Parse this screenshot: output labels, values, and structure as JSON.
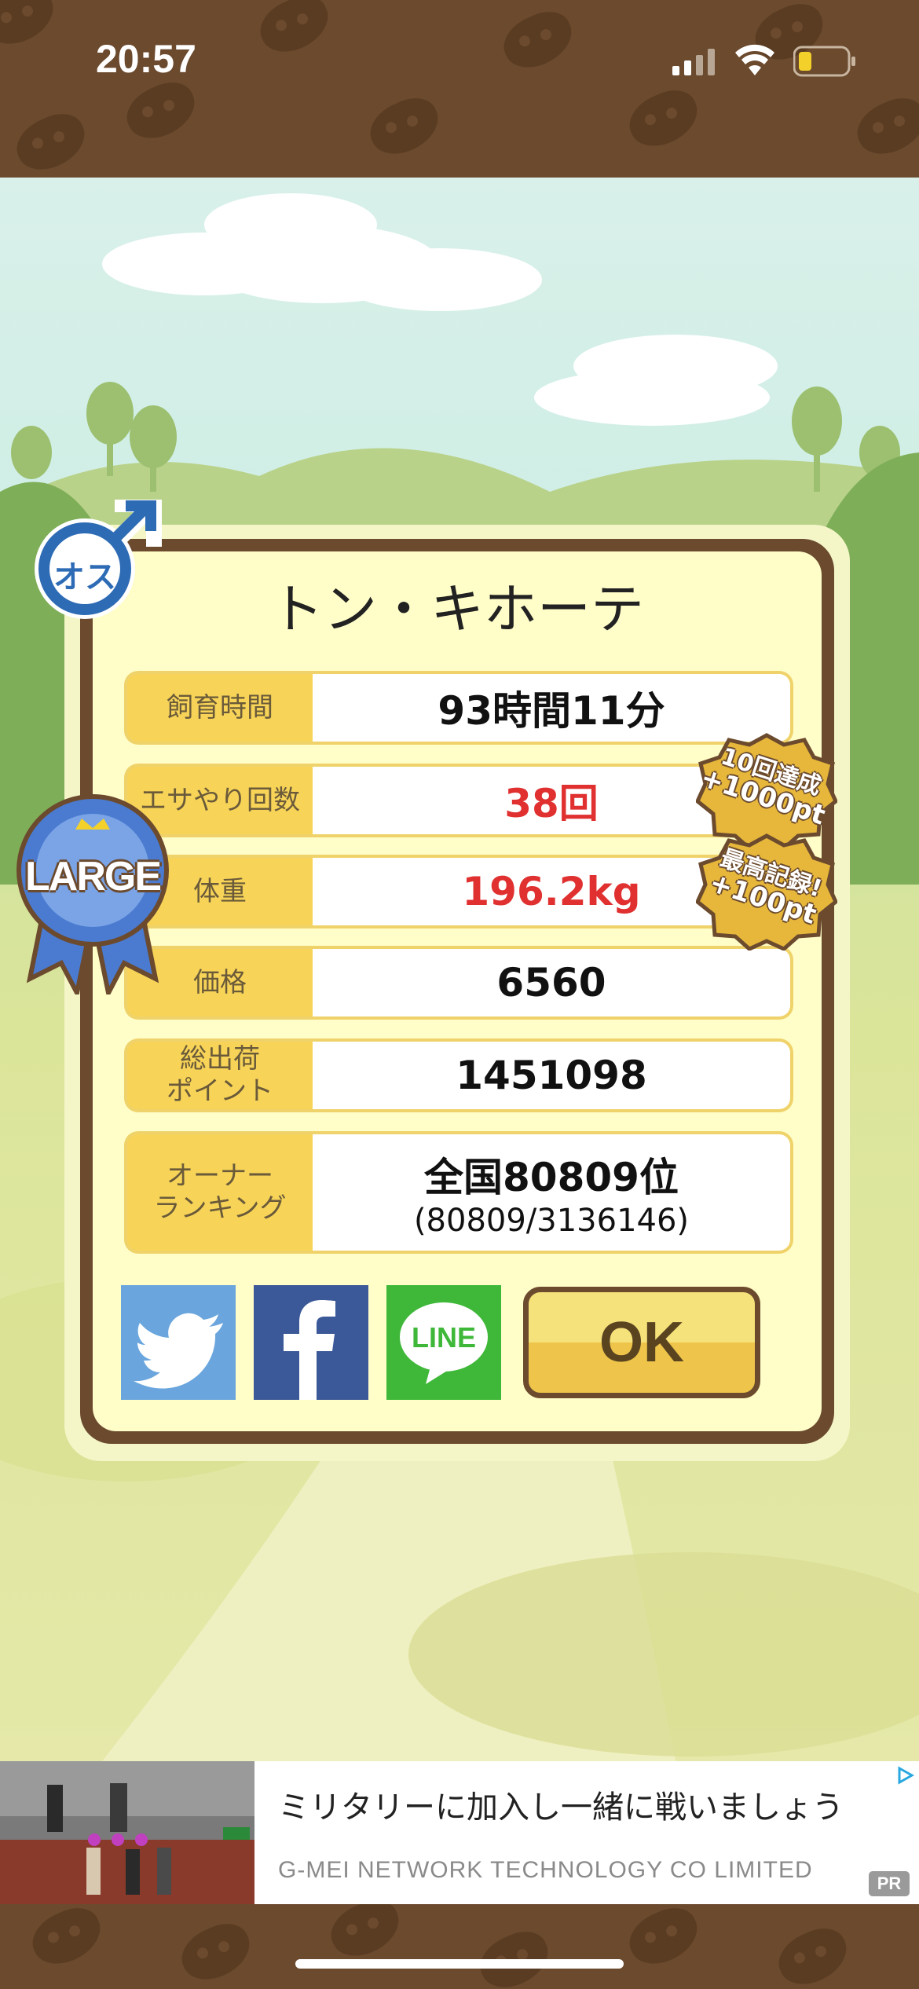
{
  "status_bar": {
    "time": "20:57"
  },
  "popup": {
    "title": "トン・キホーテ",
    "rows": [
      {
        "label": "飼育時間",
        "value": "93時間11分"
      },
      {
        "label": "エサやり回数",
        "value": "38回"
      },
      {
        "label": "体重",
        "value": "196.2kg"
      },
      {
        "label": "価格",
        "value": "6560"
      },
      {
        "label_line1": "総出荷",
        "label_line2": "ポイント",
        "value": "1451098"
      },
      {
        "label_line1": "オーナー",
        "label_line2": "ランキング",
        "value": "全国80809位",
        "sub": "(80809/3136146)"
      }
    ],
    "gender_badge": "オス",
    "size_ribbon": "LARGE",
    "achievement_1_line1": "10回達成",
    "achievement_1_line2": "+1000pt",
    "achievement_2_line1": "最高記録!",
    "achievement_2_line2": "+100pt",
    "line_label": "LINE",
    "ok_label": "OK"
  },
  "ad": {
    "title": "ミリタリーに加入し一緒に戦いましょう",
    "company": "G-MEI NETWORK TECHNOLOGY CO LIMITED",
    "badge": "PR"
  },
  "colors": {
    "brown": "#6b4a2e",
    "panel_cream": "#fffdc8",
    "label_yellow": "#f7d458",
    "highlight_red": "#e03030",
    "twitter": "#6aa6dd",
    "facebook": "#3b5998",
    "line": "#3fb83a"
  },
  "icons": [
    "male-symbol-icon",
    "large-ribbon-icon",
    "twitter-icon",
    "facebook-icon",
    "line-icon",
    "adchoices-icon",
    "signal-icon",
    "wifi-icon",
    "battery-icon"
  ]
}
